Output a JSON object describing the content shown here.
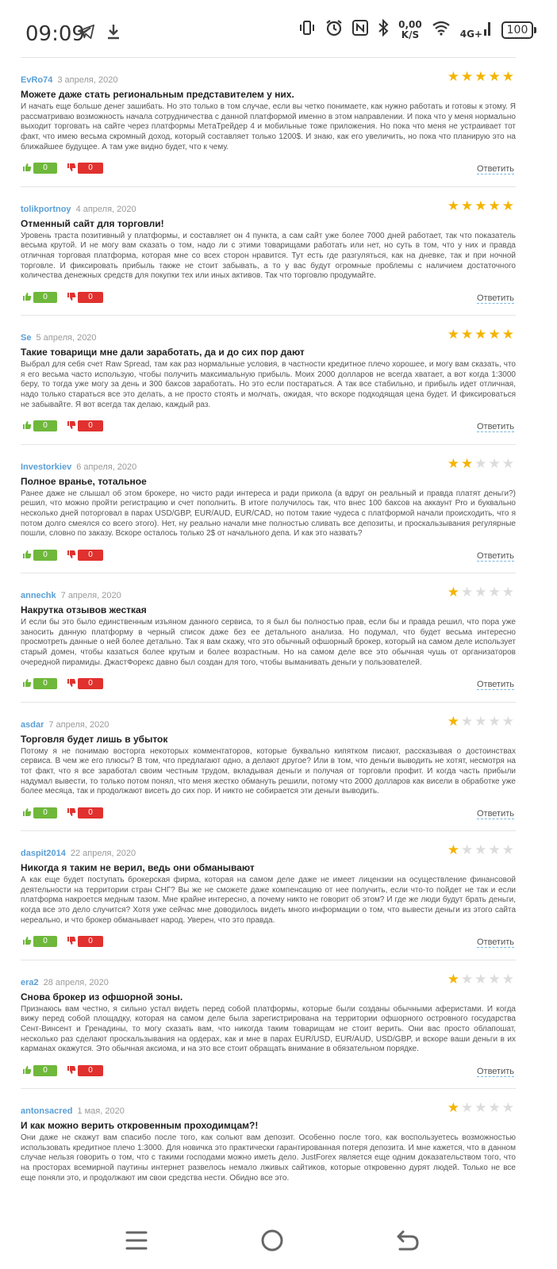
{
  "status_bar": {
    "time": "09:09",
    "speed_value": "0,00",
    "speed_unit": "K/S",
    "network": "4G+",
    "battery": "100",
    "icons": [
      "telegram-icon",
      "download-icon",
      "vibrate-icon",
      "alarm-icon",
      "nfc-icon",
      "bluetooth-icon",
      "wifi-icon",
      "signal-icon"
    ]
  },
  "reviews": {
    "reply_label": "Ответить",
    "items": [
      {
        "user": "EvRo74",
        "date": "3 апреля, 2020",
        "rating": 5,
        "title": "Можете даже стать региональным представителем у них.",
        "text": "И начать еще больше денег зашибать. Но это только в том случае, если вы четко понимаете, как нужно работать и готовы к этому. Я рассматриваю возможность начала сотрудничества с данной платформой именно в этом направлении. И пока что у меня нормально выходит торговать на сайте через платформы МетаТрейдер 4 и мобильные тоже приложения. Но пока что меня не устраивает тот факт, что имею весьма скромный доход, который составляет только 1200$. И знаю, как его увеличить, но пока что планирую это на ближайшее будущее. А там уже видно будет, что к чему.",
        "likes": "0",
        "dislikes": "0"
      },
      {
        "user": "tolikportnoy",
        "date": "4 апреля, 2020",
        "rating": 5,
        "title": "Отменный сайт для торговли!",
        "text": "Уровень траста позитивный у платформы, и составляет он 4 пункта, а сам сайт уже более 7000 дней работает, так что показатель весьма крутой. И не могу вам сказать о том, надо ли с этими товарищами работать или нет, но суть в том, что у них и правда отличная торговая платформа, которая мне со всех сторон нравится. Тут есть где разгуляться, как на дневке, так и при ночной торговле. И фиксировать прибыль также не стоит забывать, а то у вас будут огромные проблемы с наличием достаточного количества денежных средств для покупки тех или иных активов. Так что торговлю продумайте.",
        "likes": "0",
        "dislikes": "0"
      },
      {
        "user": "Se",
        "date": "5 апреля, 2020",
        "rating": 5,
        "title": "Такие товарищи мне дали заработать, да и до сих пор дают",
        "text": "Выбрал для себя счет Raw Spread, там как раз нормальные условия, в частности кредитное плечо хорошее, и могу вам сказать, что я его весьма часто использую, чтобы получить максимальную прибыль. Моих 2000 долларов не всегда хватает, а вот когда 1:3000 беру, то тогда уже могу за день и 300 баксов заработать. Но это если постараться. А так все стабильно, и прибыль идет отличная, надо только стараться все это делать, а не просто стоять и молчать, ожидая, что вскоре подходящая цена будет. И фиксироваться не забывайте. Я вот всегда так делаю, каждый раз.",
        "likes": "0",
        "dislikes": "0"
      },
      {
        "user": "Investorkiev",
        "date": "6 апреля, 2020",
        "rating": 2,
        "title": "Полное вранье, тотальное",
        "text": "Ранее даже не слышал об этом брокере, но чисто ради интереса и ради прикола (а вдруг он реальный и правда платят деньги?) решил, что можно пройти регистрацию и счет пополнить. В итоге получилось так, что внес 100 баксов на аккаунт Pro и буквально несколько дней поторговал в парах USD/GBP, EUR/AUD, EUR/CAD, но потом такие чудеса с платформой начали происходить, что я потом долго смеялся со всего этого). Нет, ну реально начали мне полностью сливать все депозиты, и проскальзывания регулярные пошли, словно по заказу. Вскоре осталось только 2$ от начального депа. И как это назвать?",
        "likes": "0",
        "dislikes": "0"
      },
      {
        "user": "annechk",
        "date": "7 апреля, 2020",
        "rating": 1,
        "title": "Накрутка отзывов жесткая",
        "text": "И если бы это было единственным изъяном данного сервиса, то я был бы полностью прав, если бы и правда решил, что пора уже заносить данную платформу в черный список даже без ее детального анализа. Но подумал, что будет весьма интересно просмотреть данные о ней более детально. Так я вам скажу, что это обычный офшорный брокер, который на самом деле использует старый домен, чтобы казаться более крутым и более возрастным. Но на самом деле все это обычная чушь от организаторов очередной пирамиды. ДжастФорекс давно был создан для того, чтобы выманивать деньги у пользователей.",
        "likes": "0",
        "dislikes": "0"
      },
      {
        "user": "asdar",
        "date": "7 апреля, 2020",
        "rating": 1,
        "title": "Торговля будет лишь в убыток",
        "text": "Потому я не понимаю восторга некоторых комментаторов, которые буквально кипятком писают, рассказывая о достоинствах сервиса. В чем же его плюсы? В том, что предлагают одно, а делают другое? Или в том, что деньги выводить не хотят, несмотря на тот факт, что я все заработал своим честным трудом, вкладывая деньги и получая от торговли профит. И когда часть прибыли надумал вывести, то только потом понял, что меня жестко обмануть решили, потому что 2000 долларов как висели в обработке уже более месяца, так и продолжают висеть до сих пор. И никто не собирается эти деньги выводить.",
        "likes": "0",
        "dislikes": "0"
      },
      {
        "user": "daspit2014",
        "date": "22 апреля, 2020",
        "rating": 1,
        "title": "Никогда я таким не верил, ведь они обманывают",
        "text": "А как еще будет поступать брокерская фирма, которая на самом деле даже не имеет лицензии на осуществление финансовой деятельности на территории стран СНГ? Вы же не сможете даже компенсацию от нее получить, если что-то пойдет не так и если платформа накроется медным тазом. Мне крайне интересно, а почему никто не говорит об этом? И где же люди будут брать деньги, когда все это дело случится? Хотя уже сейчас мне доводилось видеть много информации о том, что вывести деньги из этого сайта нереально, и что брокер обманывает народ. Уверен, что это правда.",
        "likes": "0",
        "dislikes": "0"
      },
      {
        "user": "era2",
        "date": "28 апреля, 2020",
        "rating": 1,
        "title": "Снова брокер из офшорной зоны.",
        "text": "Признаюсь вам честно, я сильно устал видеть перед собой платформы, которые были созданы обычными аферистами. И когда вижу перед собой площадку, которая на самом деле была зарегистрирована на территории офшорного островного государства Сент-Винсент и Гренадины, то могу сказать вам, что никогда таким товарищам не стоит верить. Они вас просто облапошат, несколько раз сделают проскальзывания на ордерах, как и мне в парах EUR/USD, EUR/AUD, USD/GBP, и вскоре ваши деньги в их карманах окажутся. Это обычная аксиома, и на это все стоит обращать внимание в обязательном порядке.",
        "likes": "0",
        "dislikes": "0"
      },
      {
        "user": "antonsacred",
        "date": "1 мая, 2020",
        "rating": 1,
        "title": "И как можно верить откровенным проходимцам?!",
        "text": "Они даже не скажут вам спасибо после того, как сольют вам депозит. Особенно после того, как воспользуетесь возможностью использовать кредитное плечо 1:3000. Для новичка это практически гарантированная потеря депозита. И мне кажется, что в данном случае нельзя говорить о том, что с такими господами можно иметь дело. JustForex является еще одним доказательством того, что на просторах всемирной паутины интернет развелось немало лживых сайтиков, которые откровенно дурят людей. Только не все еще поняли это, и продолжают им свои средства нести. Обидно все это.",
        "likes": "",
        "dislikes": ""
      }
    ]
  },
  "nav_bar": {
    "icons": [
      "menu-icon",
      "home-icon",
      "back-icon"
    ]
  }
}
